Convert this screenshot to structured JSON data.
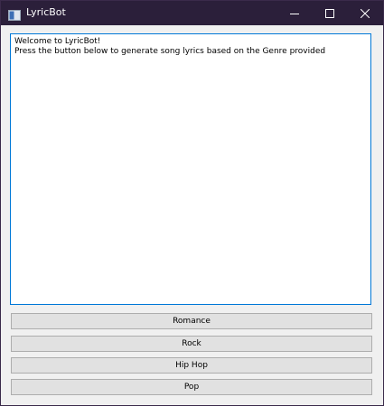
{
  "window": {
    "title": "LyricBot",
    "icon": "app-window-icon"
  },
  "titlebar_controls": {
    "minimize_icon": "minimize-icon",
    "maximize_icon": "maximize-icon",
    "close_icon": "close-icon"
  },
  "output": {
    "lines": [
      "Welcome to LyricBot!",
      "Press the button below to generate song lyrics based on the Genre provided"
    ]
  },
  "buttons": [
    {
      "label": "Romance"
    },
    {
      "label": "Rock"
    },
    {
      "label": "Hip Hop"
    },
    {
      "label": "Pop"
    }
  ],
  "colors": {
    "titlebar": "#2b1f3a",
    "focus_border": "#0078d7",
    "button_bg": "#e1e1e1",
    "button_border": "#adadad"
  }
}
